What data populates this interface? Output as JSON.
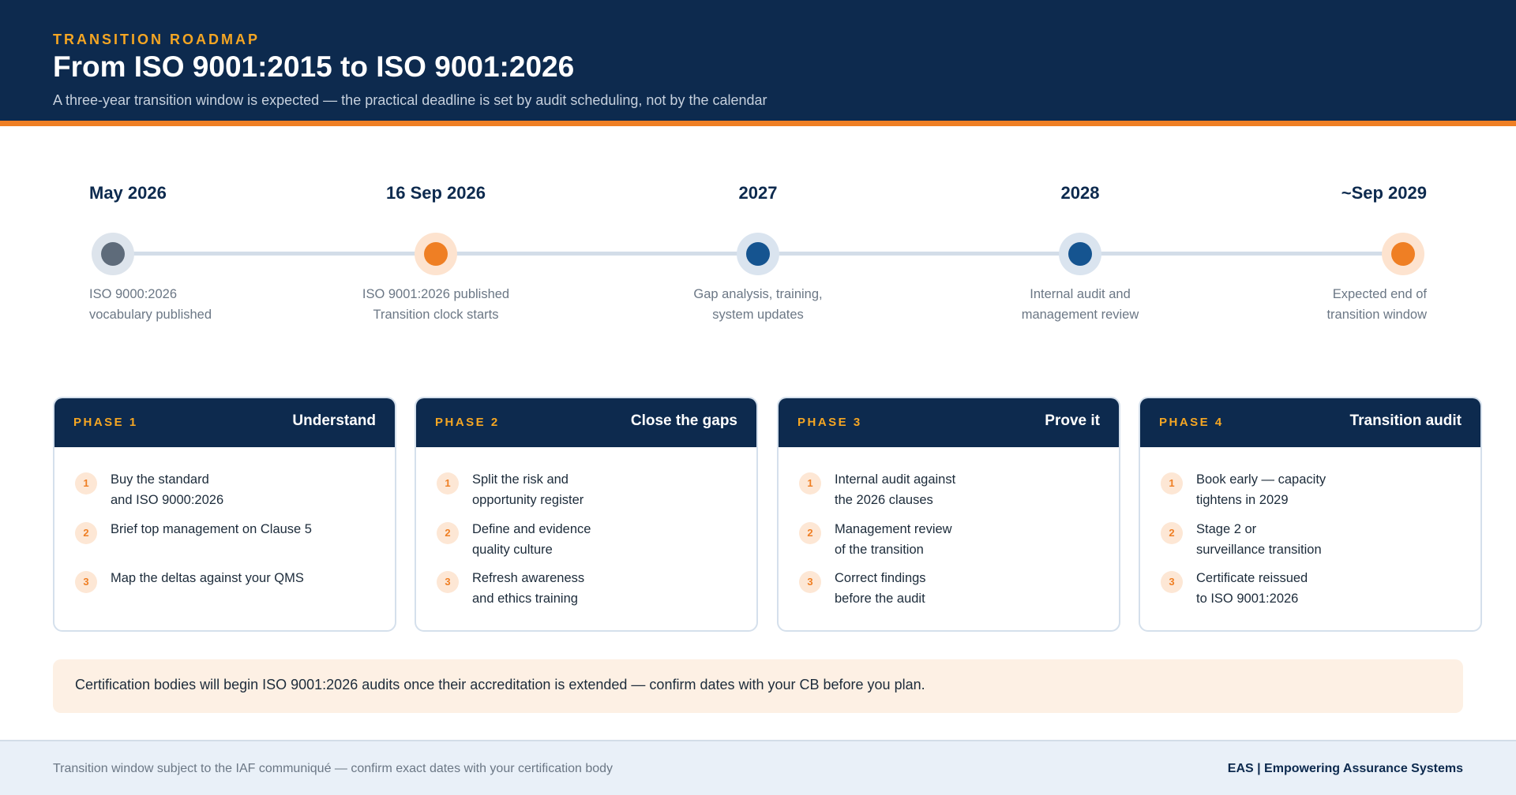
{
  "header": {
    "eyebrow": "TRANSITION ROADMAP",
    "title": "From ISO 9001:2015 to ISO 9001:2026",
    "subtitle": "A three-year transition window is expected — the practical deadline is set by audit scheduling, not by the calendar"
  },
  "timeline": {
    "milestones": [
      {
        "date": "May 2026",
        "desc": [
          "ISO 9000:2026",
          "vocabulary published"
        ],
        "color": "#5e6b7a",
        "halo": "#dde4ec"
      },
      {
        "date": "16 Sep 2026",
        "desc": [
          "ISO 9001:2026 published",
          "Transition clock starts"
        ],
        "color": "#ef7f24",
        "halo": "#fde3cf"
      },
      {
        "date": "2027",
        "desc": [
          "Gap analysis, training,",
          "system updates"
        ],
        "color": "#155490",
        "halo": "#dae4ef"
      },
      {
        "date": "2028",
        "desc": [
          "Internal audit and",
          "management review"
        ],
        "color": "#155490",
        "halo": "#dae4ef"
      },
      {
        "date": "~Sep 2029",
        "desc": [
          "Expected end of",
          "transition window"
        ],
        "color": "#ef7f24",
        "halo": "#fde3cf"
      }
    ]
  },
  "phases": [
    {
      "label": "PHASE 1",
      "name": "Understand",
      "steps": [
        {
          "num": "1",
          "lines": [
            "Buy the standard",
            "and ISO 9000:2026"
          ]
        },
        {
          "num": "2",
          "lines": [
            "Brief top management on Clause 5"
          ]
        },
        {
          "num": "3",
          "lines": [
            "Map the deltas against your QMS"
          ]
        }
      ]
    },
    {
      "label": "PHASE 2",
      "name": "Close the gaps",
      "steps": [
        {
          "num": "1",
          "lines": [
            "Split the risk and",
            "opportunity register"
          ]
        },
        {
          "num": "2",
          "lines": [
            "Define and evidence",
            "quality culture"
          ]
        },
        {
          "num": "3",
          "lines": [
            "Refresh awareness",
            "and ethics training"
          ]
        }
      ]
    },
    {
      "label": "PHASE 3",
      "name": "Prove it",
      "steps": [
        {
          "num": "1",
          "lines": [
            "Internal audit against",
            "the 2026 clauses"
          ]
        },
        {
          "num": "2",
          "lines": [
            "Management review",
            "of the transition"
          ]
        },
        {
          "num": "3",
          "lines": [
            "Correct findings",
            "before the audit"
          ]
        }
      ]
    },
    {
      "label": "PHASE 4",
      "name": "Transition audit",
      "steps": [
        {
          "num": "1",
          "lines": [
            "Book early — capacity",
            "tightens in 2029"
          ]
        },
        {
          "num": "2",
          "lines": [
            "Stage 2 or",
            "surveillance transition"
          ]
        },
        {
          "num": "3",
          "lines": [
            "Certificate reissued",
            "to ISO 9001:2026"
          ]
        }
      ]
    }
  ],
  "note": {
    "text": "Certification bodies will begin ISO 9001:2026 audits once their accreditation is extended — confirm dates with your CB before you plan."
  },
  "footer": {
    "left": "Transition window subject to the IAF communiqué — confirm exact dates with your certification body",
    "right": "EAS | Empowering Assurance Systems"
  }
}
